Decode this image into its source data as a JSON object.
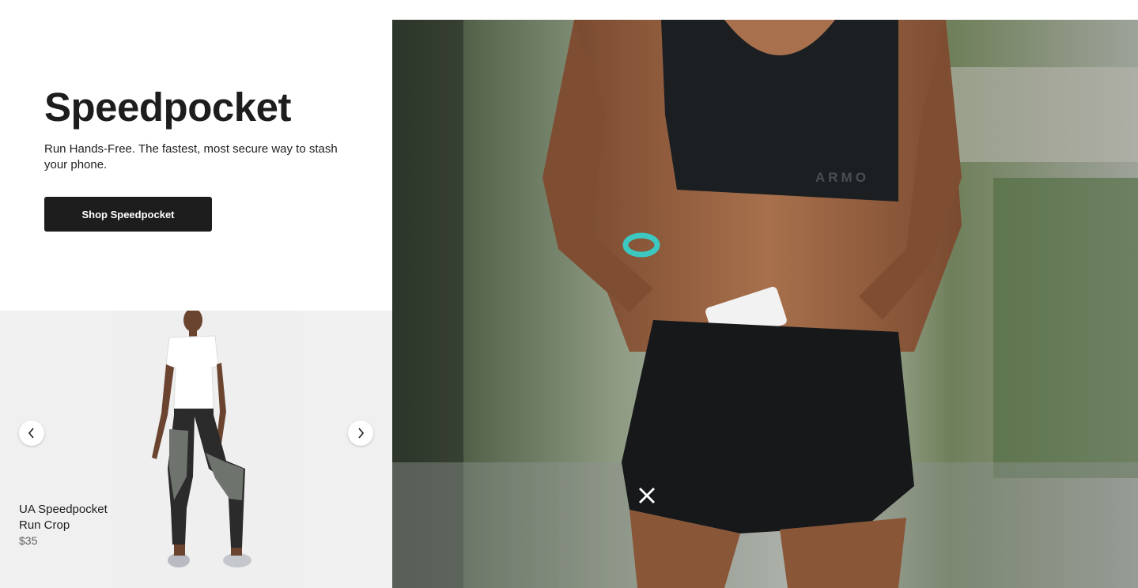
{
  "promo": {
    "title": "Speedpocket",
    "description": "Run Hands-Free. The fastest, most secure way to stash your phone.",
    "cta_label": "Shop Speedpocket"
  },
  "carousel": {
    "product": {
      "name": "UA Speedpocket Run Crop",
      "price": "$35"
    },
    "prev_icon": "chevron-left-icon",
    "next_icon": "chevron-right-icon"
  },
  "hero": {
    "image": "runner-woman-speedpocket-photo",
    "brand_text": "ARMO"
  },
  "colors": {
    "button_bg": "#1d1d1d",
    "carousel_bg": "#f0f0f0",
    "text": "#1d1d1d",
    "bracelet": "#3cc8c0"
  }
}
